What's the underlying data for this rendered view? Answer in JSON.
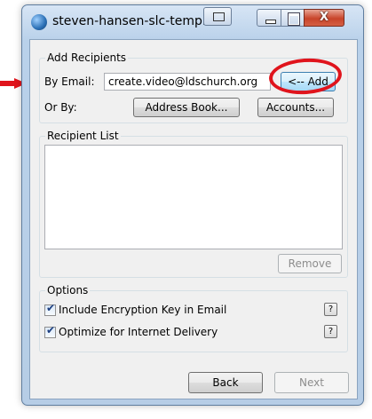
{
  "window": {
    "title": "steven-hansen-slc-temple",
    "close_glyph": "X"
  },
  "add_recipients": {
    "legend": "Add Recipients",
    "by_email_label": "By Email:",
    "email_value": "create.video@ldschurch.org",
    "add_button": "<-- Add",
    "or_by_label": "Or By:",
    "address_book_button": "Address Book...",
    "accounts_button": "Accounts..."
  },
  "recipient_list": {
    "legend": "Recipient List",
    "items": [],
    "remove_button": "Remove"
  },
  "options": {
    "legend": "Options",
    "include_encryption_key": {
      "label": "Include Encryption Key in Email",
      "checked": true
    },
    "optimize_internet": {
      "label": "Optimize for Internet Delivery",
      "checked": true
    },
    "help_glyph": "?"
  },
  "footer": {
    "back_button": "Back",
    "next_button": "Next"
  },
  "annotations": {
    "arrow_color": "#e0141c",
    "circle_color": "#e0141c"
  }
}
